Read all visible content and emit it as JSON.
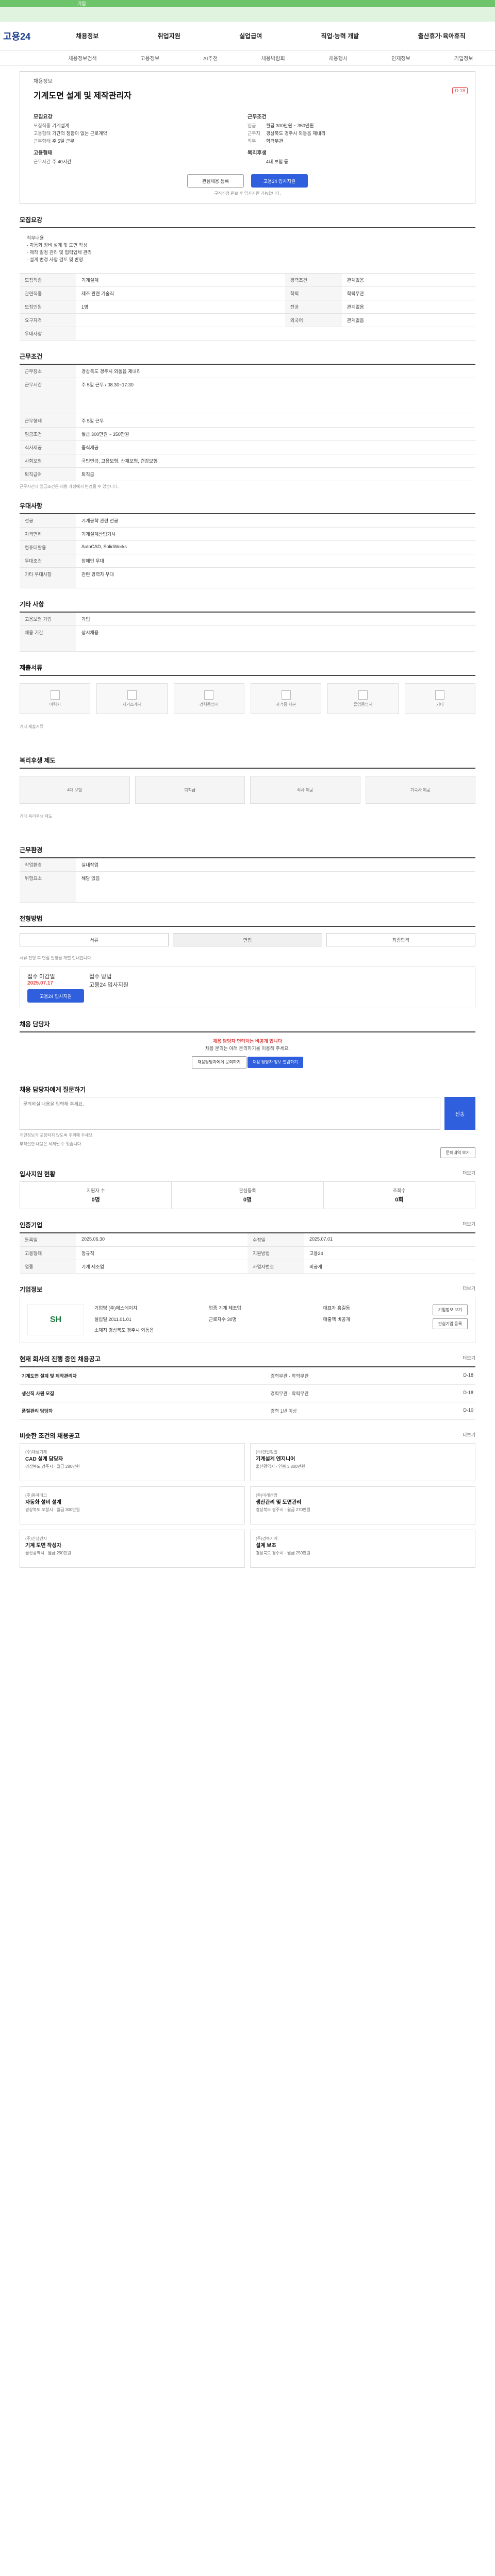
{
  "banner": {
    "text": "기업"
  },
  "gnb": {
    "logo": "고용24",
    "menu": [
      "채용정보",
      "취업지원",
      "실업급여",
      "직업·능력 개발",
      "출산휴가·육아휴직"
    ]
  },
  "snb": [
    "채용정보검색",
    "고용정보",
    "AI추천",
    "채용박람회",
    "채용행사",
    "인재정보",
    "기업정보"
  ],
  "job": {
    "org": "채용정보",
    "title": "기계도면 설계 및 제작관리자",
    "dday": "D-18",
    "left_head": "모집요강",
    "left": [
      [
        "모집직종",
        "기계설계"
      ],
      [
        "고용형태",
        "기간의 정함이 없는 근로계약"
      ],
      [
        "근무형태",
        "주 5일 근무"
      ]
    ],
    "left2_head": "고용형태",
    "left2": [
      [
        "근무시간",
        "주 40시간"
      ]
    ],
    "right_head": "근무조건",
    "right": [
      [
        "임금",
        "월급 300만원 ~ 350만원"
      ],
      [
        "근무지",
        "경상북도 경주시 외동읍 제내리"
      ],
      [
        "직무",
        "학력무관"
      ]
    ],
    "right2_head": "복리후생",
    "right2": [
      [
        "",
        "4대 보험 등"
      ]
    ],
    "btn_scrap": "관심채용 등록",
    "btn_apply": "고용24 입사지원",
    "note": "구직신청 완료 후 입사지원 가능합니다."
  },
  "detail": {
    "title": "모집요강",
    "intro": "직무내용\n- 자동화 장비 설계 및 도면 작성\n- 제작 일정 관리 및 협력업체 관리\n- 설계 변경 사항 검토 및 반영",
    "rows": [
      [
        "모집직종",
        "기계설계",
        "경력조건",
        "관계없음"
      ],
      [
        "관련직종",
        "제조 관련 기술직",
        "학력",
        "학력무관"
      ],
      [
        "모집인원",
        "1명",
        "전공",
        "관계없음"
      ],
      [
        "요구자격",
        "",
        "외국어",
        "관계없음"
      ],
      [
        "우대사항",
        "",
        "",
        ""
      ]
    ]
  },
  "cond": {
    "title": "근무조건",
    "rows": [
      [
        "근무장소",
        "경상북도 경주시 외동읍 제내리"
      ],
      [
        "근무시간",
        "주 5일 근무 / 08:30~17:30"
      ],
      [
        "근무형태",
        "주 5일 근무"
      ],
      [
        "임금조건",
        "월급 300만원 ~ 350만원"
      ],
      [
        "식사제공",
        "중식제공"
      ],
      [
        "사회보험",
        "국민연금, 고용보험, 산재보험, 건강보험"
      ],
      [
        "퇴직급여",
        "퇴직금"
      ]
    ],
    "note": "근무시간과 임금조건은 채용 과정에서 변경될 수 있습니다."
  },
  "rules": {
    "title": "우대사항",
    "rows": [
      [
        "전공",
        "기계공학 관련 전공"
      ],
      [
        "자격면허",
        "기계설계산업기사"
      ],
      [
        "컴퓨터활용",
        "AutoCAD, SolidWorks"
      ],
      [
        "우대조건",
        "장애인 우대"
      ],
      [
        "기타 우대사항",
        "관련 경력자 우대"
      ]
    ]
  },
  "pref": {
    "title": "기타 사항",
    "rows": [
      [
        "고용보험 가입",
        "가입"
      ],
      [
        "채용 기간",
        "상시채용"
      ]
    ]
  },
  "docs": {
    "title": "제출서류",
    "items": [
      "이력서",
      "자기소개서",
      "경력증명서",
      "자격증 사본",
      "졸업증명서",
      "기타"
    ],
    "note": "기타 제출서류"
  },
  "welfare": {
    "title": "복리후생 제도",
    "items": [
      "4대 보험",
      "퇴직금",
      "식사 제공",
      "기숙사 제공"
    ],
    "note": "기타 복리후생 제도"
  },
  "facility": {
    "title": "근무환경",
    "rows": [
      [
        "작업환경",
        "실내작업"
      ],
      [
        "위험요소",
        "해당 없음"
      ]
    ]
  },
  "process": {
    "title": "전형방법",
    "steps": [
      "서류",
      "면접",
      "최종합격"
    ],
    "desc": "서류 전형 후 면접 일정을 개별 안내합니다.",
    "label_period": "접수 마감일",
    "period": "2025.07.17",
    "label_way": "접수 방법",
    "way": "고용24 입사지원",
    "apply_btn": "고용24 입사지원"
  },
  "contact": {
    "title": "채용 담당자",
    "warn_title": "채용 담당자 연락처는 비공개 입니다",
    "warn_text": "채용 문의는 아래 문의하기를 이용해 주세요.",
    "btn1": "채용담당자에게 문의하기",
    "btn2": "채용 담당자 정보 열람하기"
  },
  "qna": {
    "title": "채용 담당자에게 질문하기",
    "placeholder": "문의하실 내용을 입력해 주세요.",
    "send": "전송",
    "notes": [
      "개인정보가 포함되지 않도록 주의해 주세요.",
      "부적절한 내용은 삭제될 수 있습니다."
    ],
    "more_btn": "문의내역 보기"
  },
  "stats": {
    "title": "입사지원 현황",
    "more": "더보기",
    "items": [
      [
        "지원자 수",
        "0명"
      ],
      [
        "관심등록",
        "0명"
      ],
      [
        "조회수",
        "0회"
      ]
    ]
  },
  "meta": {
    "title": "인증기업",
    "more": "더보기",
    "rows": [
      [
        "등록일",
        "2025.06.30",
        "수정일",
        "2025.07.01"
      ],
      [
        "고용형태",
        "정규직",
        "지원방법",
        "고용24"
      ],
      [
        "업종",
        "기계 제조업",
        "사업자번호",
        "비공개"
      ]
    ]
  },
  "company": {
    "title": "기업정보",
    "more": "더보기",
    "logo": "SH",
    "rows": [
      [
        "기업명",
        "(주)에스에이치"
      ],
      [
        "업종",
        "기계 제조업"
      ],
      [
        "대표자",
        "홍길동"
      ],
      [
        "설립일",
        "2011.01.01"
      ],
      [
        "근로자수",
        "30명"
      ],
      [
        "매출액",
        "비공개"
      ],
      [
        "소재지",
        "경상북도 경주시 외동읍"
      ]
    ],
    "btns": [
      "기업정보 보기",
      "관심기업 등록"
    ]
  },
  "related": {
    "title": "현재 회사의 진행 중인 채용공고",
    "more": "더보기",
    "items": [
      [
        "기계도면 설계 및 제작관리자",
        "경력무관 · 학력무관",
        "D-18"
      ],
      [
        "생산직 사원 모집",
        "경력무관 · 학력무관",
        "D-18"
      ],
      [
        "품질관리 담당자",
        "경력 1년 이상",
        "D-10"
      ]
    ]
  },
  "similar": {
    "title": "비슷한 조건의 채용공고",
    "more": "더보기",
    "items": [
      [
        "(주)대성기계",
        "CAD 설계 담당자",
        "경상북도 경주시 · 월급 280만원"
      ],
      [
        "(주)한일정밀",
        "기계설계 엔지니어",
        "울산광역시 · 연봉 3,800만원"
      ],
      [
        "(주)동아테크",
        "자동화 설비 설계",
        "경상북도 포항시 · 월급 300만원"
      ],
      [
        "(주)미래산업",
        "생산관리 및 도면관리",
        "경상북도 경주시 · 월급 270만원"
      ],
      [
        "(주)신성엔지",
        "기계 도면 작성자",
        "울산광역시 · 월급 290만원"
      ],
      [
        "(주)경북기계",
        "설계 보조",
        "경상북도 경주시 · 월급 250만원"
      ]
    ]
  }
}
